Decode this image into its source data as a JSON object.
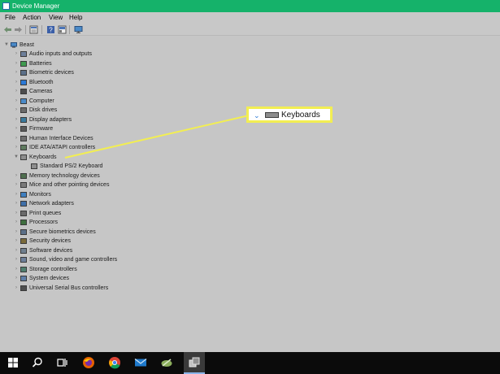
{
  "window": {
    "title": "Device Manager"
  },
  "menu": [
    {
      "label": "File"
    },
    {
      "label": "Action"
    },
    {
      "label": "View"
    },
    {
      "label": "Help"
    }
  ],
  "toolbar": [
    {
      "icon": "back-arrow-icon"
    },
    {
      "icon": "forward-arrow-icon"
    },
    {
      "icon": "properties-icon"
    },
    {
      "icon": "help-icon"
    },
    {
      "icon": "update-driver-icon"
    },
    {
      "icon": "scan-monitor-icon"
    }
  ],
  "tree": {
    "root": {
      "label": "Beast",
      "expanded": true
    },
    "categories": [
      {
        "label": "Audio inputs and outputs",
        "icon": "speaker-icon"
      },
      {
        "label": "Batteries",
        "icon": "battery-icon"
      },
      {
        "label": "Biometric devices",
        "icon": "fingerprint-icon"
      },
      {
        "label": "Bluetooth",
        "icon": "bluetooth-icon"
      },
      {
        "label": "Cameras",
        "icon": "camera-icon"
      },
      {
        "label": "Computer",
        "icon": "computer-icon"
      },
      {
        "label": "Disk drives",
        "icon": "disk-drive-icon"
      },
      {
        "label": "Display adapters",
        "icon": "display-adapter-icon"
      },
      {
        "label": "Firmware",
        "icon": "firmware-icon"
      },
      {
        "label": "Human Interface Devices",
        "icon": "hid-icon"
      },
      {
        "label": "IDE ATA/ATAPI controllers",
        "icon": "ide-controller-icon"
      },
      {
        "label": "Keyboards",
        "icon": "keyboard-icon",
        "expanded": true
      },
      {
        "label": "Standard PS/2 Keyboard",
        "icon": "keyboard-icon",
        "child": true
      },
      {
        "label": "Memory technology devices",
        "icon": "memory-icon"
      },
      {
        "label": "Mice and other pointing devices",
        "icon": "mouse-icon"
      },
      {
        "label": "Monitors",
        "icon": "monitor-icon"
      },
      {
        "label": "Network adapters",
        "icon": "network-adapter-icon"
      },
      {
        "label": "Print queues",
        "icon": "printer-icon"
      },
      {
        "label": "Processors",
        "icon": "processor-icon"
      },
      {
        "label": "Secure biometrics devices",
        "icon": "fingerprint-icon"
      },
      {
        "label": "Security devices",
        "icon": "security-device-icon"
      },
      {
        "label": "Software devices",
        "icon": "software-device-icon"
      },
      {
        "label": "Sound, video and game controllers",
        "icon": "sound-icon"
      },
      {
        "label": "Storage controllers",
        "icon": "storage-controller-icon"
      },
      {
        "label": "System devices",
        "icon": "system-device-icon"
      },
      {
        "label": "Universal Serial Bus controllers",
        "icon": "usb-icon"
      }
    ]
  },
  "callout": {
    "label": "Keyboards",
    "color": "#f2ee52"
  },
  "taskbar": [
    {
      "icon": "windows-start-icon"
    },
    {
      "icon": "search-icon"
    },
    {
      "icon": "task-view-icon"
    },
    {
      "icon": "firefox-icon"
    },
    {
      "icon": "chrome-icon"
    },
    {
      "icon": "mail-icon"
    },
    {
      "icon": "app-icon"
    },
    {
      "icon": "device-manager-icon",
      "active": true
    }
  ],
  "colors": {
    "titlebar": "#15b26a",
    "accent": "#2b79d6",
    "highlight": "#f2ee52",
    "taskbar": "#0b0b0b"
  }
}
